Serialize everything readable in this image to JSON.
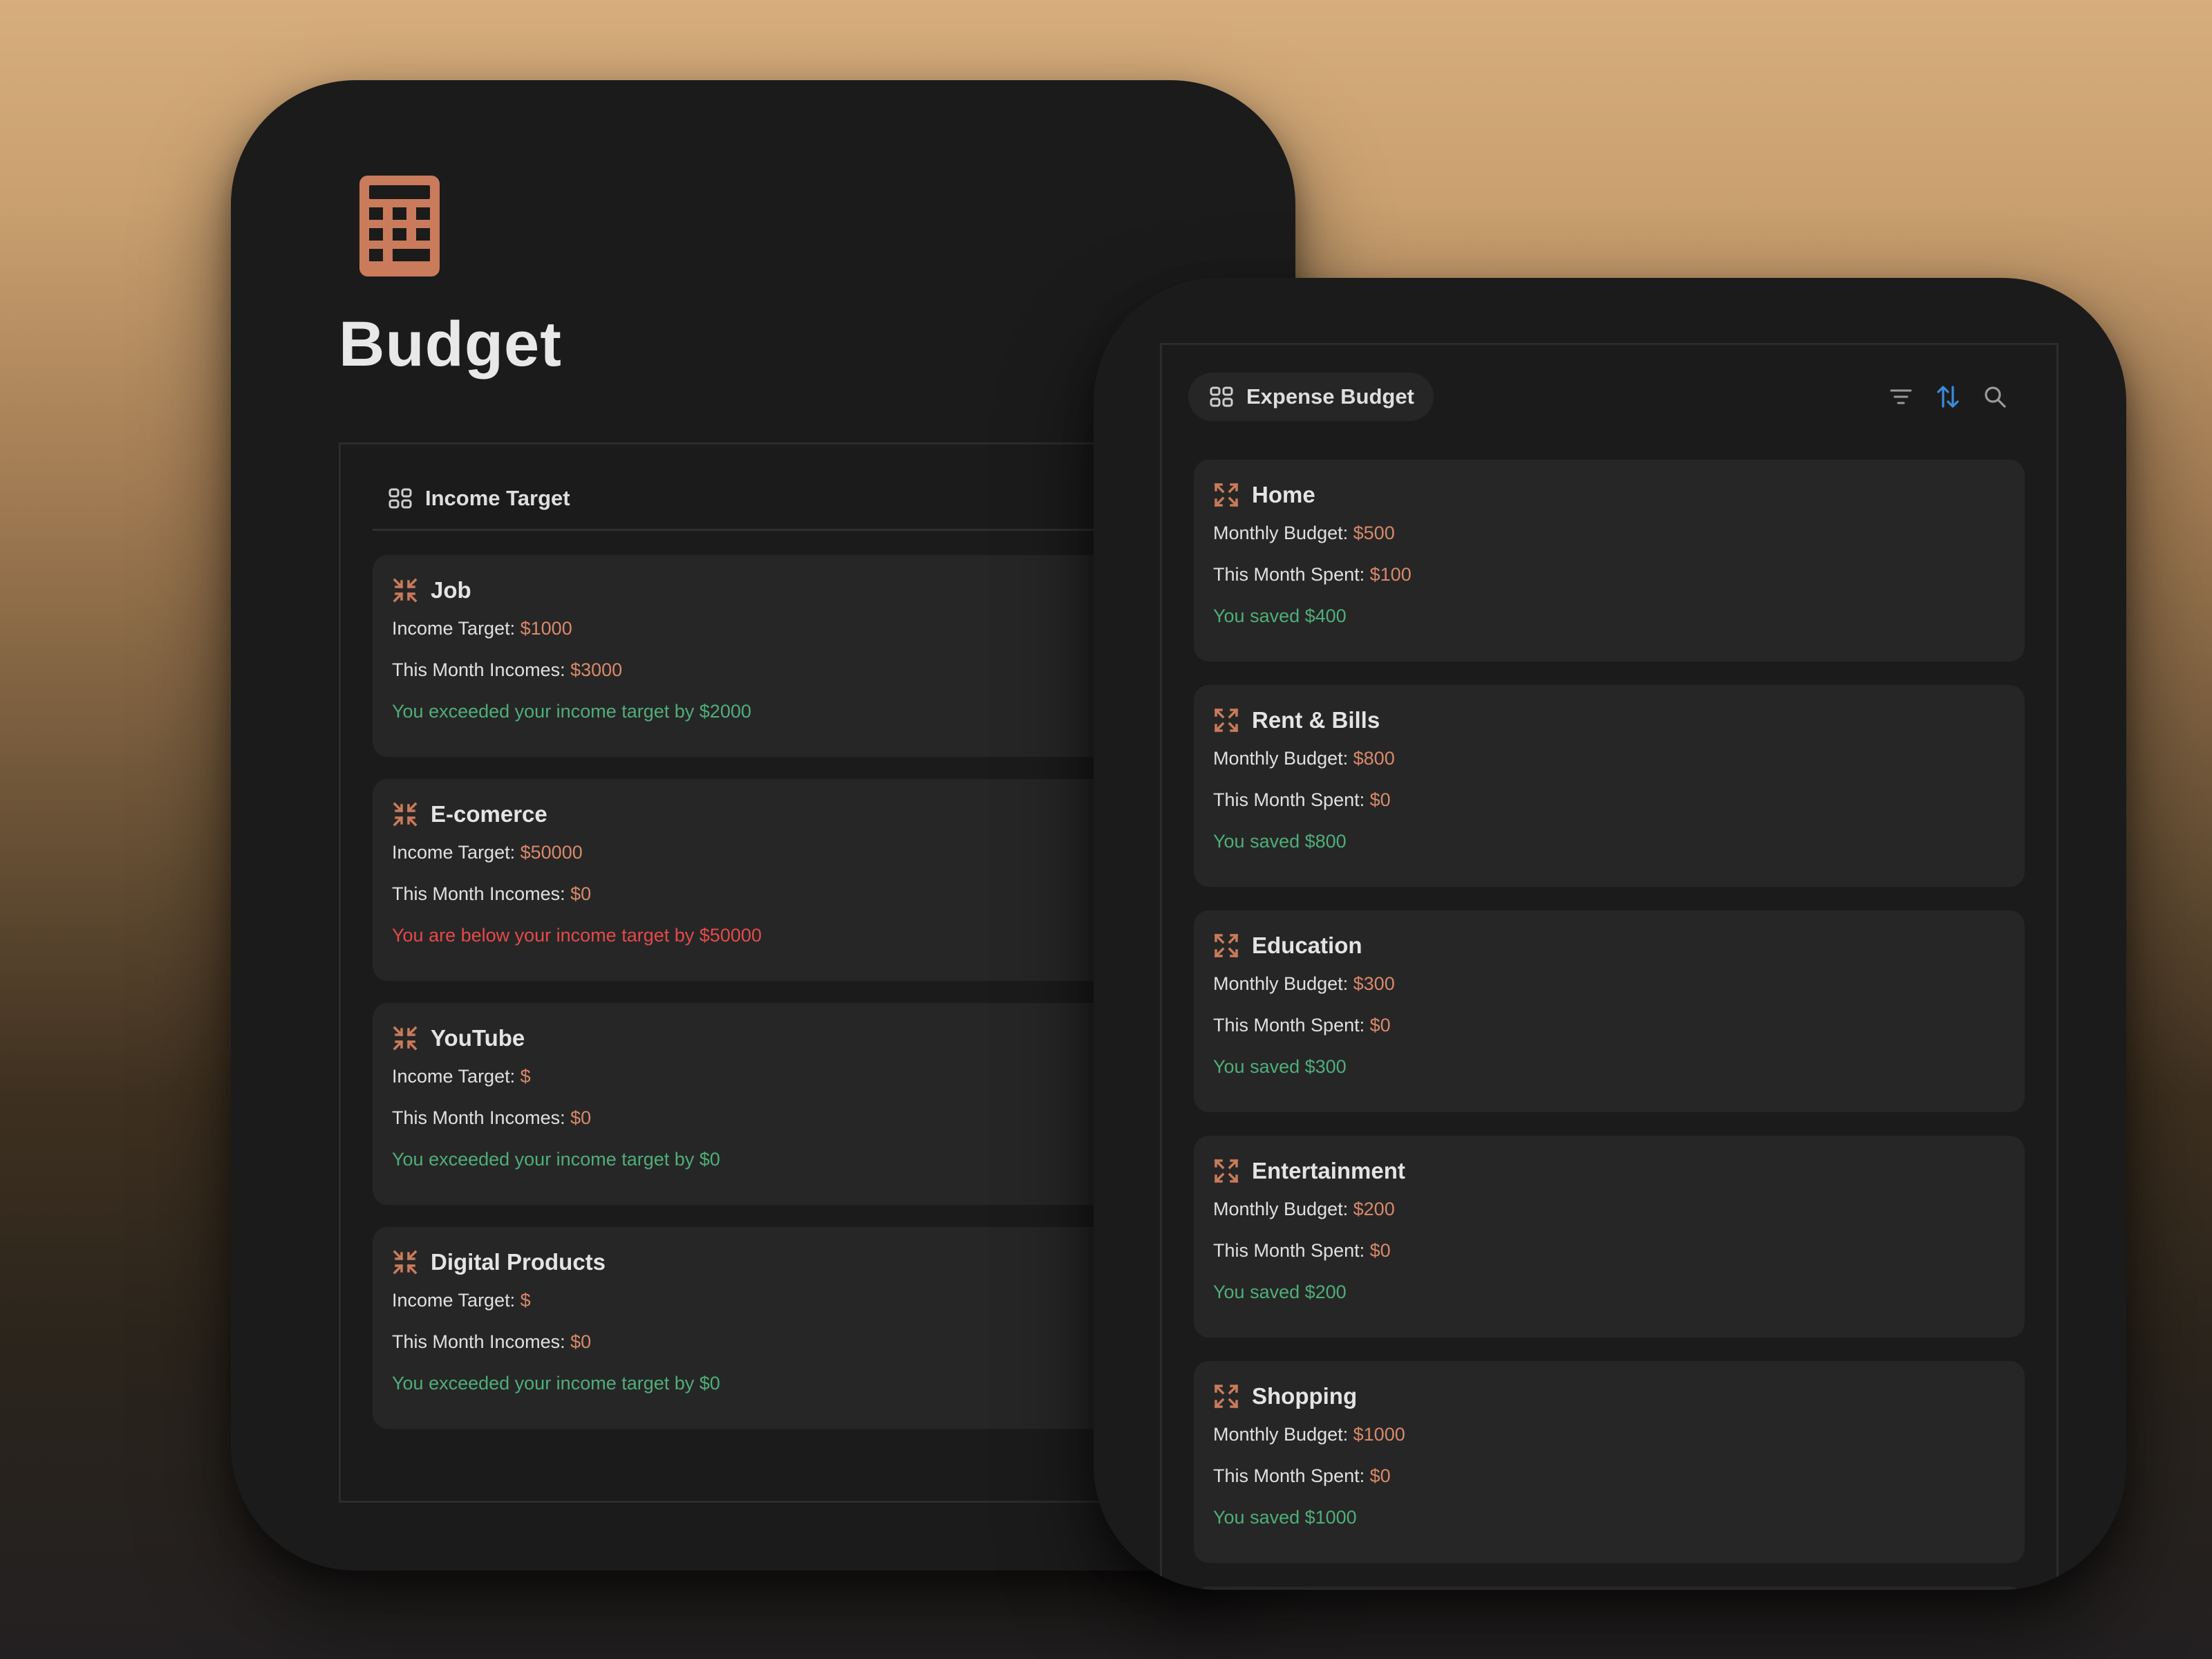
{
  "colors": {
    "accent": "#c97b5b",
    "value": "#d9896a",
    "positive": "#4fae79",
    "negative": "#e44a4a",
    "sort_icon": "#3a8dde"
  },
  "budget_page": {
    "title": "Budget",
    "page_icon": "calculator-icon"
  },
  "income": {
    "view_title": "Income Target",
    "cards": [
      {
        "name": "Job",
        "target_label": "Income Target:",
        "target": "$1000",
        "incomes_label": "This Month Incomes:",
        "incomes": "$3000",
        "status": "You exceeded your income target by $2000",
        "status_type": "positive"
      },
      {
        "name": "E-comerce",
        "target_label": "Income Target:",
        "target": "$50000",
        "incomes_label": "This Month Incomes:",
        "incomes": "$0",
        "status": "You are below your income target by $50000",
        "status_type": "negative"
      },
      {
        "name": "YouTube",
        "target_label": "Income Target:",
        "target": "$",
        "incomes_label": "This Month Incomes:",
        "incomes": "$0",
        "status": "You exceeded your income target by $0",
        "status_type": "positive"
      },
      {
        "name": "Digital Products",
        "target_label": "Income Target:",
        "target": "$",
        "incomes_label": "This Month Incomes:",
        "incomes": "$0",
        "status": "You exceeded your income target by $0",
        "status_type": "positive"
      }
    ]
  },
  "expense": {
    "view_title": "Expense Budget",
    "toolbar_icons": [
      "filter-icon",
      "sort-icon",
      "search-icon"
    ],
    "cards": [
      {
        "name": "Home",
        "budget_label": "Monthly Budget:",
        "budget": "$500",
        "spent_label": "This Month Spent:",
        "spent": "$100",
        "status": "You saved $400"
      },
      {
        "name": "Rent & Bills",
        "budget_label": "Monthly Budget:",
        "budget": "$800",
        "spent_label": "This Month Spent:",
        "spent": "$0",
        "status": "You saved $800"
      },
      {
        "name": "Education",
        "budget_label": "Monthly Budget:",
        "budget": "$300",
        "spent_label": "This Month Spent:",
        "spent": "$0",
        "status": "You saved $300"
      },
      {
        "name": "Entertainment",
        "budget_label": "Monthly Budget:",
        "budget": "$200",
        "spent_label": "This Month Spent:",
        "spent": "$0",
        "status": "You saved $200"
      },
      {
        "name": "Shopping",
        "budget_label": "Monthly Budget:",
        "budget": "$1000",
        "spent_label": "This Month Spent:",
        "spent": "$0",
        "status": "You saved $1000"
      }
    ]
  }
}
